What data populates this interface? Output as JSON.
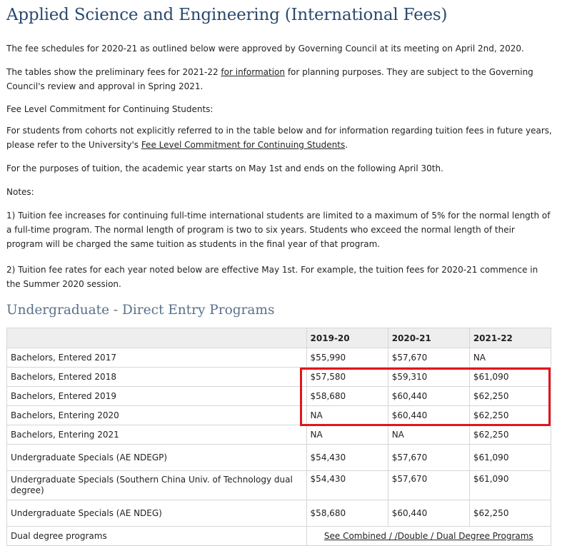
{
  "page": {
    "title": "Applied Science and Engineering (International Fees)"
  },
  "intro": {
    "p1": "The fee schedules for 2020-21 as outlined below were approved by Governing Council at its meeting on April 2nd, 2020.",
    "p2_before": "The tables show the preliminary fees for 2021-22 ",
    "p2_link": "for information",
    "p2_after": " for planning purposes. They are subject to the Governing Council's review and approval in Spring 2021.",
    "p3": "Fee Level Commitment for Continuing Students:",
    "p4_before": "For students from cohorts not explicitly referred to in the table below and for information regarding tuition fees in future years, please refer to the University's ",
    "p4_link": "Fee Level Commitment for Continuing Students",
    "p4_after": ".",
    "p5": "For the purposes of tuition, the academic year starts on May 1st and ends on the following April 30th.",
    "notes_label": "Notes:",
    "note1": "1) Tuition fee increases for continuing full-time international students are limited to a maximum of 5% for the normal length of a full-time program. The normal length of program is two to six years. Students who exceed the normal length of their program will be charged the same tuition as students in the final year of that program.",
    "note2": "2) Tuition fee rates for each year noted below are effective May 1st. For example, the tuition fees for 2020-21 commence in the Summer 2020 session."
  },
  "section": {
    "title": "Undergraduate - Direct Entry Programs"
  },
  "table": {
    "headers": [
      "",
      "2019-20",
      "2020-21",
      "2021-22"
    ],
    "rows": [
      [
        "Bachelors, Entered 2017",
        "$55,990",
        "$57,670",
        "NA"
      ],
      [
        "Bachelors, Entered 2018",
        "$57,580",
        "$59,310",
        "$61,090"
      ],
      [
        "Bachelors, Entered 2019",
        "$58,680",
        "$60,440",
        "$62,250"
      ],
      [
        "Bachelors, Entering 2020",
        "NA",
        "$60,440",
        "$62,250"
      ],
      [
        "Bachelors, Entering 2021",
        "NA",
        "NA",
        "$62,250"
      ],
      [
        "Undergraduate Specials (AE NDEGP)",
        "$54,430",
        "$57,670",
        "$61,090"
      ],
      [
        "Undergraduate Specials (Southern China Univ. of Technology dual degree)",
        "$54,430",
        "$57,670",
        "$61,090"
      ],
      [
        "Undergraduate Specials (AE NDEG)",
        "$58,680",
        "$60,440",
        "$62,250"
      ]
    ],
    "last_row_label": "Dual degree programs",
    "last_row_link": "See Combined / /Double / Dual Degree Programs"
  },
  "colors": {
    "title": "#2a4a6e",
    "section_title": "#5a7089",
    "highlight": "#e0161f",
    "header_bg": "#eeeeee",
    "border": "#d6d6d6"
  }
}
